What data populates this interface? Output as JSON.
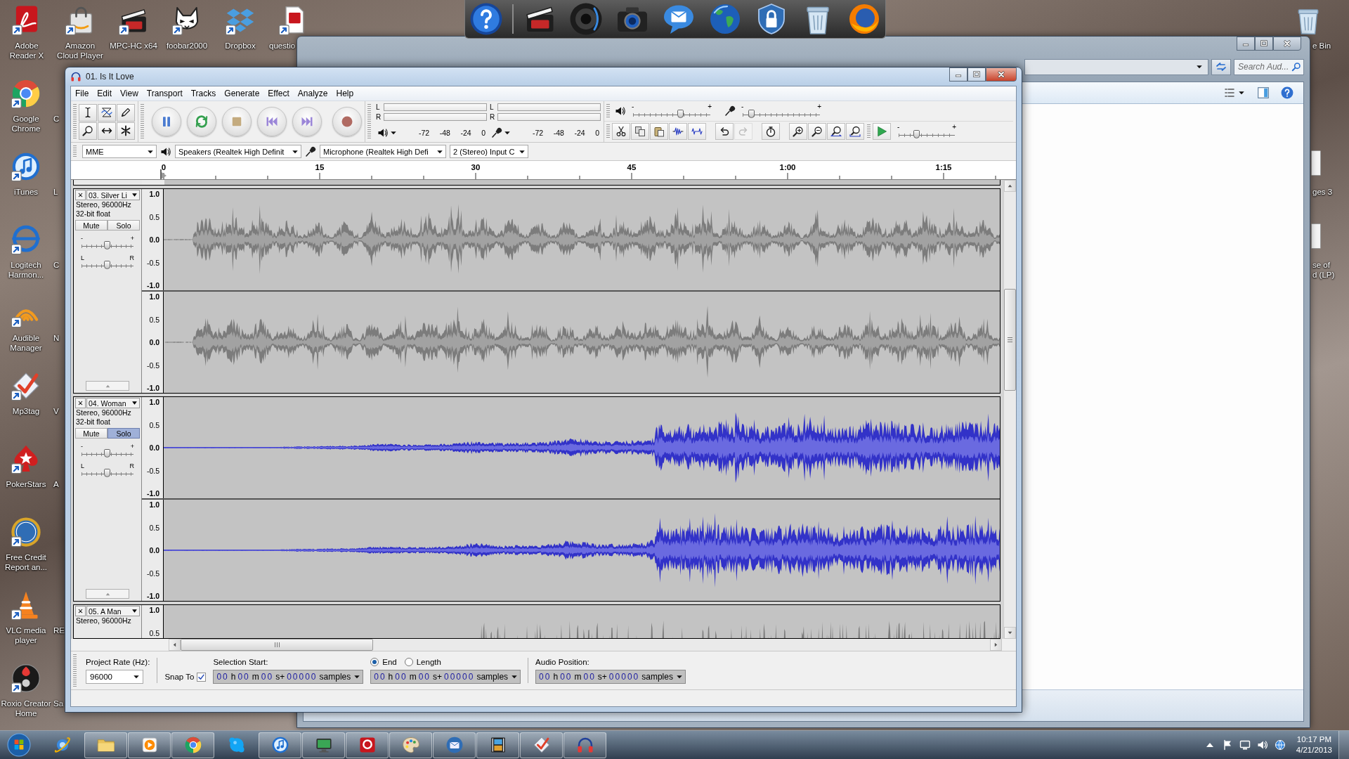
{
  "desktop": {
    "top_icons": [
      {
        "label": "Adobe Reader X"
      },
      {
        "label": "Amazon Cloud Player"
      },
      {
        "label": "MPC-HC x64"
      },
      {
        "label": "foobar2000"
      },
      {
        "label": "Dropbox"
      },
      {
        "label": "questio"
      }
    ],
    "left_icons": [
      {
        "label": "Google Chrome",
        "beside": "C"
      },
      {
        "label": "iTunes",
        "beside": "L"
      },
      {
        "label": "Logitech Harmon...",
        "beside": "C"
      },
      {
        "label": "Audible Manager",
        "beside": "N"
      },
      {
        "label": "Mp3tag",
        "beside": "V"
      },
      {
        "label": "PokerStars",
        "beside": "A"
      },
      {
        "label": "Free Credit Report an..."
      },
      {
        "label": "VLC media player",
        "beside": "RE"
      },
      {
        "label": "Roxio Creator Home",
        "beside": "Sa"
      }
    ],
    "right_icons": [
      {
        "lines": [
          "e Bin"
        ]
      },
      {
        "lines": [
          "ges 3"
        ]
      },
      {
        "lines": [
          "se of",
          "d (LP)"
        ]
      }
    ]
  },
  "explorer": {
    "search": {
      "placeholder": "Search Aud..."
    }
  },
  "audacity": {
    "title": "01. Is It Love",
    "menu": [
      "File",
      "Edit",
      "View",
      "Transport",
      "Tracks",
      "Generate",
      "Effect",
      "Analyze",
      "Help"
    ],
    "meters": [
      {
        "kind": "playback",
        "channels": [
          "L",
          "R"
        ],
        "scale": [
          "-72",
          "-48",
          "-24",
          "0"
        ]
      },
      {
        "kind": "record",
        "channels": [
          "L",
          "R"
        ],
        "scale": [
          "-72",
          "-48",
          "-24",
          "0"
        ]
      }
    ],
    "mixer": [
      {
        "kind": "output",
        "labels": [
          "-",
          "+"
        ],
        "level": 0.62
      },
      {
        "kind": "input",
        "labels": [
          "-",
          "+"
        ],
        "level": 0.12
      }
    ],
    "history": [
      {
        "kind": "undo",
        "disabled": false
      },
      {
        "kind": "redo",
        "disabled": true
      }
    ],
    "play_at_speed": {
      "labels": [
        "-",
        "+"
      ],
      "level": 0.33
    },
    "devices": {
      "host": "MME",
      "output": "Speakers (Realtek High Definit",
      "input": "Microphone (Realtek High Defi",
      "channels": "2 (Stereo) Input C"
    },
    "ruler": [
      "0",
      "15",
      "30",
      "45",
      "1:00",
      "1:15"
    ],
    "tracks": [
      {
        "name": "03. Silver Li",
        "info": [
          "Stereo, 96000Hz",
          "32-bit float"
        ],
        "controls": {
          "mute": {
            "label": "Mute",
            "on": false
          },
          "solo": {
            "label": "Solo",
            "on": false
          },
          "gain": {
            "labels": [
              "-",
              "+"
            ],
            "level": 0.5
          },
          "pan": {
            "labels": [
              "L",
              "R"
            ],
            "level": 0.5
          }
        },
        "channels": [
          {
            "ruler": [
              "1.0",
              "0.5",
              "0.0",
              "-0.5",
              "-1.0"
            ]
          },
          {
            "ruler": [
              "1.0",
              "0.5",
              "0.0",
              "-0.5",
              "-1.0"
            ]
          }
        ]
      },
      {
        "name": "04. Woman",
        "info": [
          "Stereo, 96000Hz",
          "32-bit float"
        ],
        "controls": {
          "mute": {
            "label": "Mute",
            "on": false
          },
          "solo": {
            "label": "Solo",
            "on": true
          },
          "gain": {
            "labels": [
              "-",
              "+"
            ],
            "level": 0.5
          },
          "pan": {
            "labels": [
              "L",
              "R"
            ],
            "level": 0.5
          }
        },
        "channels": [
          {
            "ruler": [
              "1.0",
              "0.5",
              "0.0",
              "-0.5",
              "-1.0"
            ]
          },
          {
            "ruler": [
              "1.0",
              "0.5",
              "0.0",
              "-0.5",
              "-1.0"
            ]
          }
        ]
      },
      {
        "name": "05. A Man",
        "info": [
          "Stereo, 96000Hz"
        ],
        "channels": [
          {
            "ruler": [
              "1.0",
              "0.5"
            ]
          }
        ]
      }
    ],
    "selection_bar": {
      "rate": {
        "label": "Project Rate (Hz):",
        "value": "96000"
      },
      "snap": {
        "label": "Snap To",
        "checked": true
      },
      "start": {
        "label": "Selection Start:",
        "time": [
          {
            "kind": "digits",
            "text": "00"
          },
          {
            "kind": "unit",
            "text": "h"
          },
          {
            "kind": "digits",
            "text": "00"
          },
          {
            "kind": "unit",
            "text": "m"
          },
          {
            "kind": "digits",
            "text": "00"
          },
          {
            "kind": "unit",
            "text": "s+"
          },
          {
            "kind": "digits",
            "text": "00000"
          },
          {
            "kind": "unit",
            "text": "samples"
          }
        ]
      },
      "modes": [
        {
          "label": "End",
          "selected": true
        },
        {
          "label": "Length",
          "selected": false
        }
      ],
      "end": {
        "time": [
          {
            "kind": "digits",
            "text": "00"
          },
          {
            "kind": "unit",
            "text": "h"
          },
          {
            "kind": "digits",
            "text": "00"
          },
          {
            "kind": "unit",
            "text": "m"
          },
          {
            "kind": "digits",
            "text": "00"
          },
          {
            "kind": "unit",
            "text": "s+"
          },
          {
            "kind": "digits",
            "text": "00000"
          },
          {
            "kind": "unit",
            "text": "samples"
          }
        ]
      },
      "position": {
        "label": "Audio Position:",
        "time": [
          {
            "kind": "digits",
            "text": "00"
          },
          {
            "kind": "unit",
            "text": "h"
          },
          {
            "kind": "digits",
            "text": "00"
          },
          {
            "kind": "unit",
            "text": "m"
          },
          {
            "kind": "digits",
            "text": "00"
          },
          {
            "kind": "unit",
            "text": "s+"
          },
          {
            "kind": "digits",
            "text": "00000"
          },
          {
            "kind": "unit",
            "text": "samples"
          }
        ]
      }
    }
  },
  "taskbar": {
    "apps": [
      {
        "running": false
      },
      {
        "running": true
      },
      {
        "running": true
      },
      {
        "running": true
      },
      {
        "running": false
      },
      {
        "running": true
      },
      {
        "running": true
      },
      {
        "running": true
      },
      {
        "running": true
      },
      {
        "running": true
      },
      {
        "running": true
      },
      {
        "running": true
      },
      {
        "running": true
      }
    ],
    "clock": {
      "time": "10:17 PM",
      "date": "4/21/2013"
    }
  }
}
